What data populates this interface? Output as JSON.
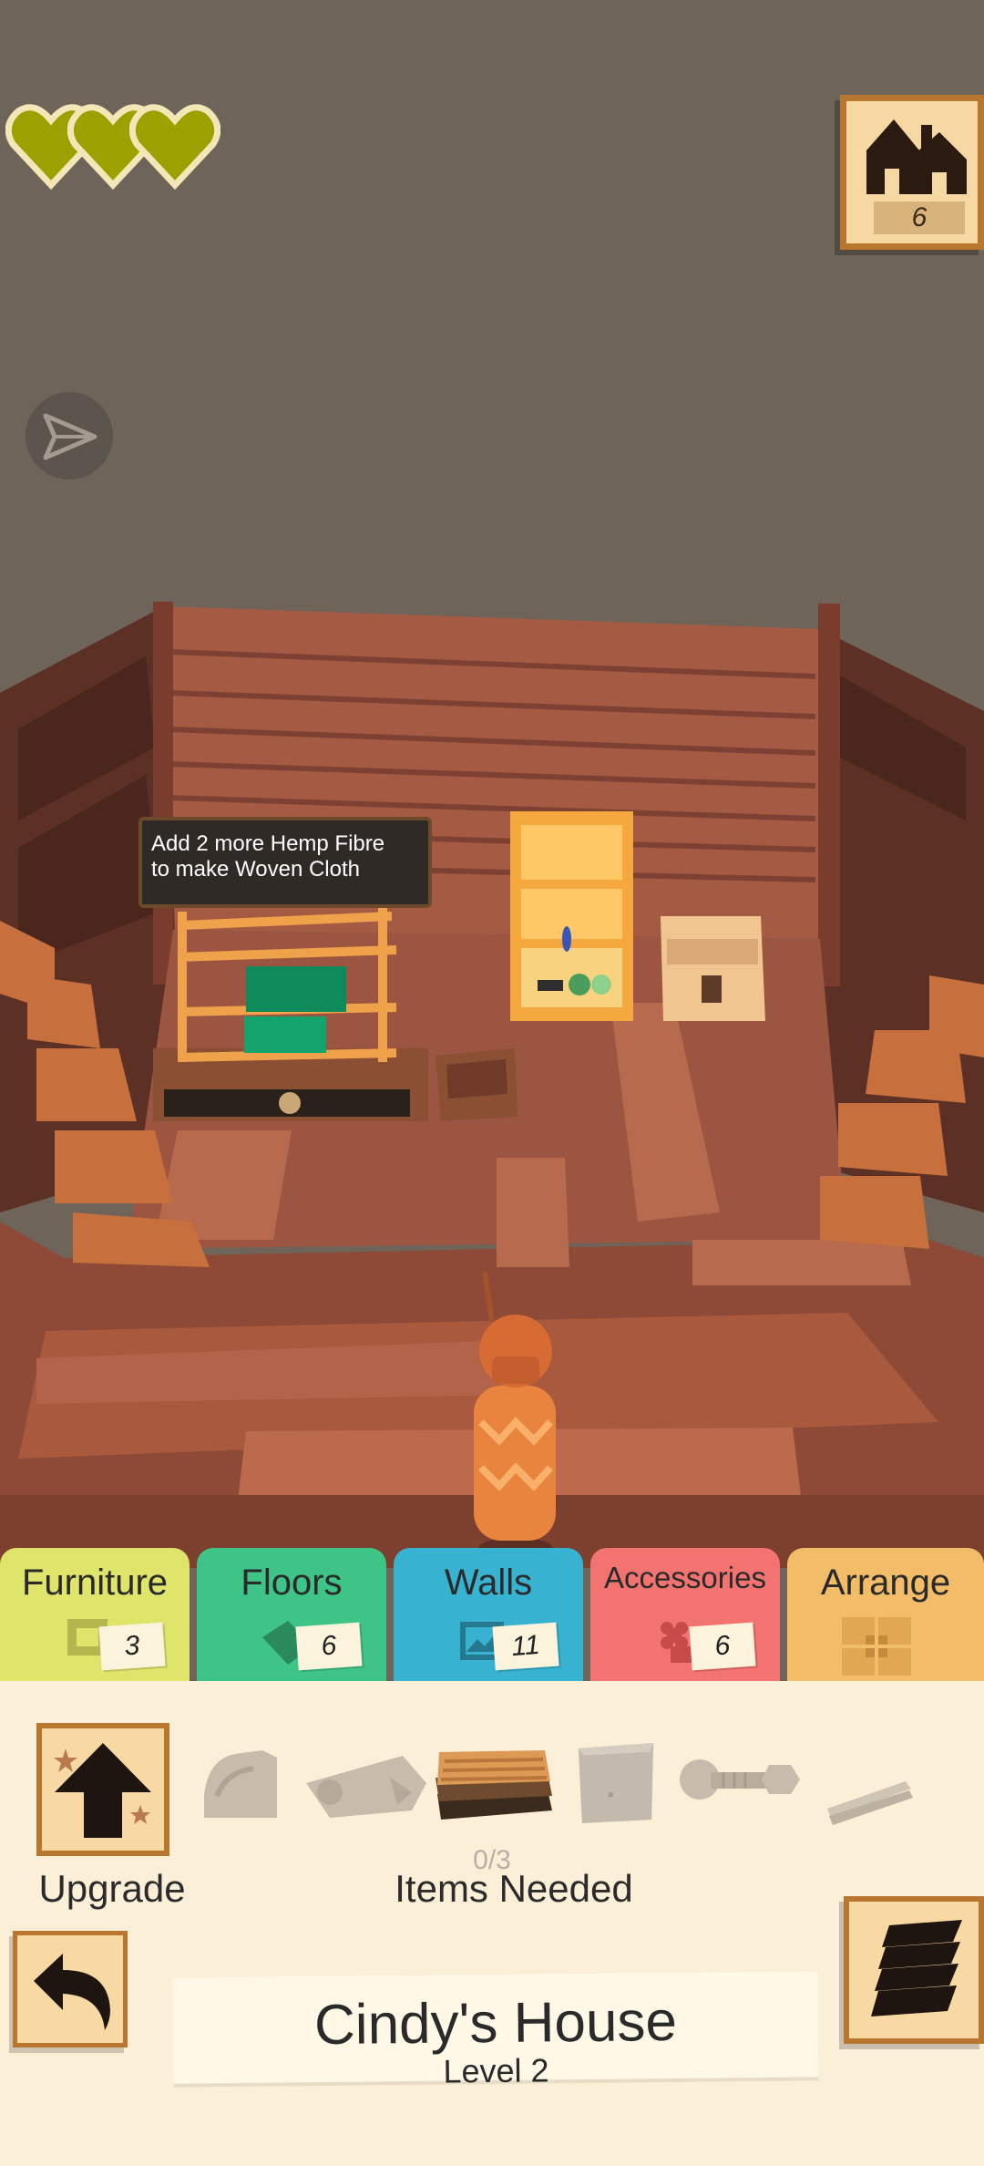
{
  "hud": {
    "hearts": {
      "count": 3,
      "color": "#9ba200",
      "outline": "#f4e7b7"
    },
    "house_button": {
      "icon": "house-icon",
      "count": "6"
    },
    "send_button": {
      "icon": "send-icon"
    }
  },
  "scene": {
    "hint": {
      "line1": "Add 2 more Hemp Fibre",
      "line2": "to make Woven Cloth"
    }
  },
  "tabs": [
    {
      "label": "Furniture",
      "count": "3",
      "color": "#dfe46b",
      "icon": "chair-icon"
    },
    {
      "label": "Floors",
      "count": "6",
      "color": "#3fc487",
      "icon": "floor-tile-icon"
    },
    {
      "label": "Walls",
      "count": "11",
      "color": "#37b3d1",
      "icon": "wall-frame-icon",
      "selected": true
    },
    {
      "label": "Accessories",
      "count": "6",
      "color": "#f2736f",
      "icon": "flower-icon"
    },
    {
      "label": "Arrange",
      "count": "",
      "color": "#f3bc68",
      "icon": "arrange-grid-icon"
    }
  ],
  "panel": {
    "upgrade_label": "Upgrade",
    "items_count": "0/3",
    "items_label": "Items Needed",
    "items": [
      {
        "name": "corner-trim-item"
      },
      {
        "name": "log-item"
      },
      {
        "name": "wood-planks-item",
        "highlighted": true
      },
      {
        "name": "stone-slab-item"
      },
      {
        "name": "bolt-item"
      },
      {
        "name": "sticks-item"
      }
    ],
    "house_name": "Cindy's House",
    "house_level": "Level 2"
  }
}
